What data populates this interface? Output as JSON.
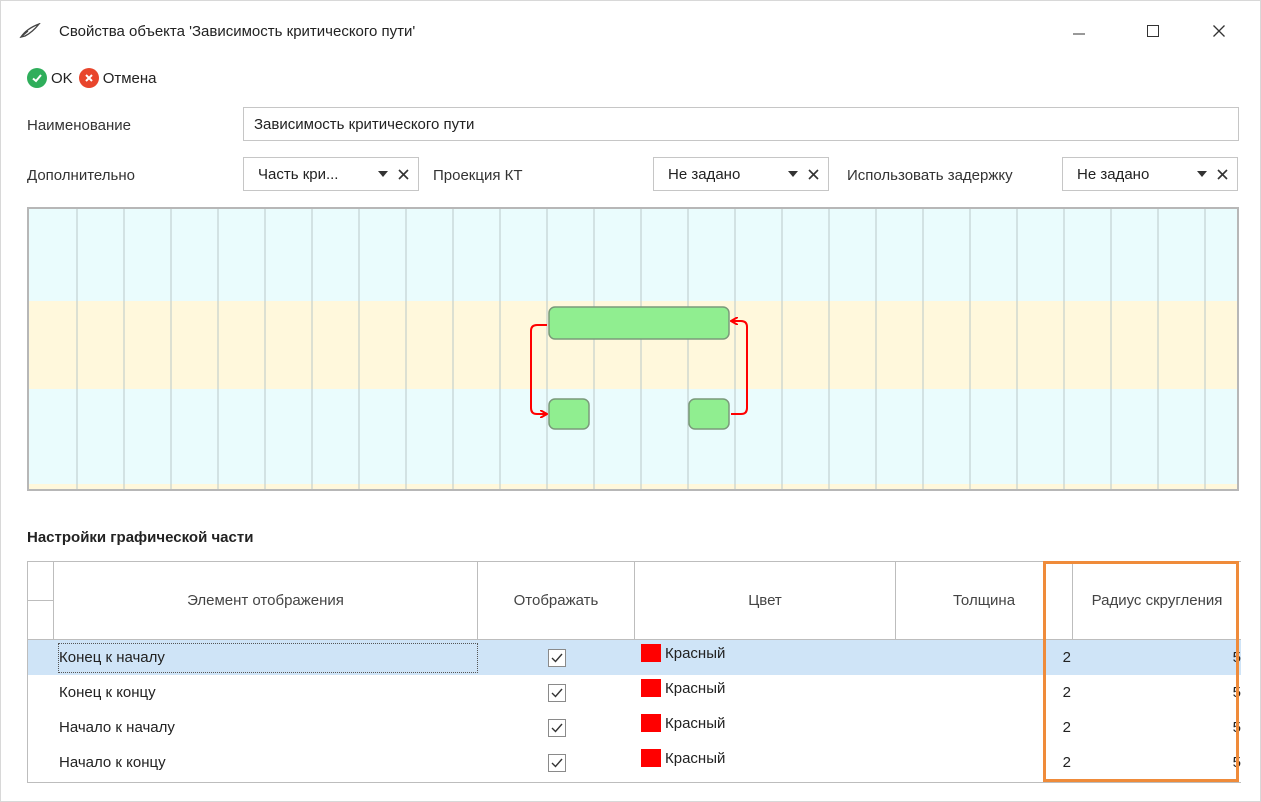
{
  "window": {
    "title": "Свойства объекта 'Зависимость критического пути'",
    "icon": "feather-icon"
  },
  "toolbar": {
    "ok_label": "OK",
    "cancel_label": "Отмена"
  },
  "form": {
    "name_label": "Наименование",
    "name_value": "Зависимость критического пути",
    "extra_label": "Дополнительно",
    "extra_value": "Часть кри...",
    "projection_label": "Проекция КТ",
    "projection_value": "Не задано",
    "delay_label": "Использовать задержку",
    "delay_value": "Не задано"
  },
  "section_title": "Настройки графической части",
  "grid": {
    "columns": [
      "Элемент отображения",
      "Отображать",
      "Цвет",
      "Толщина",
      "Радиус скругления"
    ],
    "rows": [
      {
        "element": "Конец к началу",
        "show": true,
        "color": "Красный",
        "thickness": "2",
        "radius": "5"
      },
      {
        "element": "Конец к концу",
        "show": true,
        "color": "Красный",
        "thickness": "2",
        "radius": "5"
      },
      {
        "element": "Начало к началу",
        "show": true,
        "color": "Красный",
        "thickness": "2",
        "radius": "5"
      },
      {
        "element": "Начало к концу",
        "show": true,
        "color": "Красный",
        "thickness": "2",
        "radius": "5"
      }
    ],
    "selected_row": 0
  },
  "colors": {
    "swatch_red": "#ff0000",
    "selection": "#cfe4f7",
    "highlight": "#ef8b3a",
    "task_green": "#90ee90",
    "link_red": "#ff0000"
  }
}
